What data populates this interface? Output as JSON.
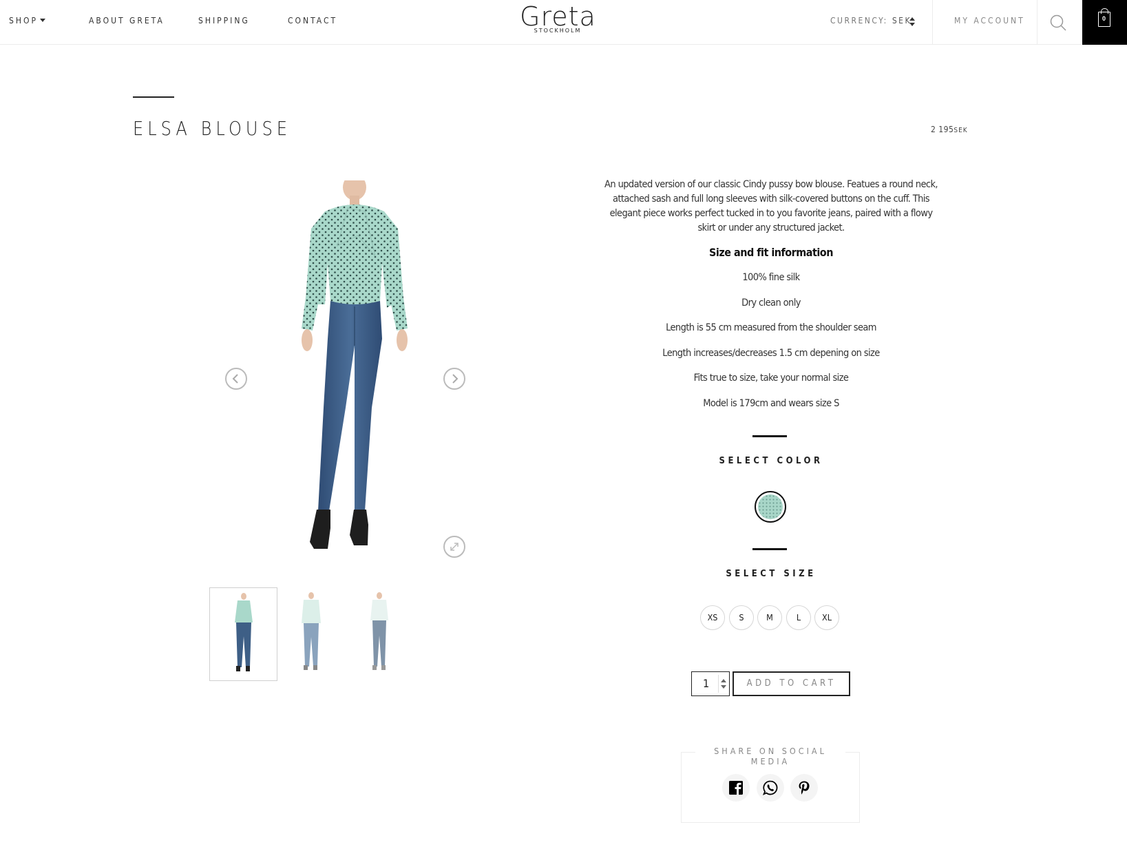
{
  "nav": {
    "shop": "SHOP",
    "about": "ABOUT GRETA",
    "shipping": "SHIPPING",
    "contact": "CONTACT"
  },
  "logo": {
    "name": "Greta",
    "sub": "STOCKHOLM"
  },
  "currency": {
    "label": "CURRENCY:",
    "value": "SEK"
  },
  "account": "MY ACCOUNT",
  "cart": {
    "count": "0"
  },
  "product": {
    "title": "ELSA BLOUSE",
    "price_amount": "2 195",
    "price_currency": "SEK",
    "description": "An updated version of our classic Cindy pussy bow blouse. Featues a round neck, attached sash and full long sleeves with silk-covered buttons on the cuff. This elegant piece works perfect tucked in to you favorite jeans, paired with a flowy skirt or under any structured jacket.",
    "size_heading": "Size and fit information",
    "specs": [
      "100% fine silk",
      "Dry clean only",
      "Length is 55 cm measured from the shoulder seam",
      "Length increases/decreases 1.5 cm depening on size",
      "Fits true to size, take your normal size",
      "Model is 179cm and wears size S"
    ],
    "select_color_label": "SELECT COLOR",
    "color_swatch": "#a8d6c8",
    "select_size_label": "SELECT SIZE",
    "sizes": [
      "XS",
      "S",
      "M",
      "L",
      "XL"
    ],
    "quantity": "1",
    "add_to_cart": "ADD TO CART"
  },
  "share": {
    "label": "SHARE ON SOCIAL MEDIA",
    "networks": [
      "facebook-icon",
      "whatsapp-icon",
      "pinterest-icon"
    ]
  },
  "colors": {
    "blouse": "#a8d6c8",
    "jeans": "#3e5f86",
    "light_jeans": "#8aa3bd",
    "accent": "#000000"
  }
}
